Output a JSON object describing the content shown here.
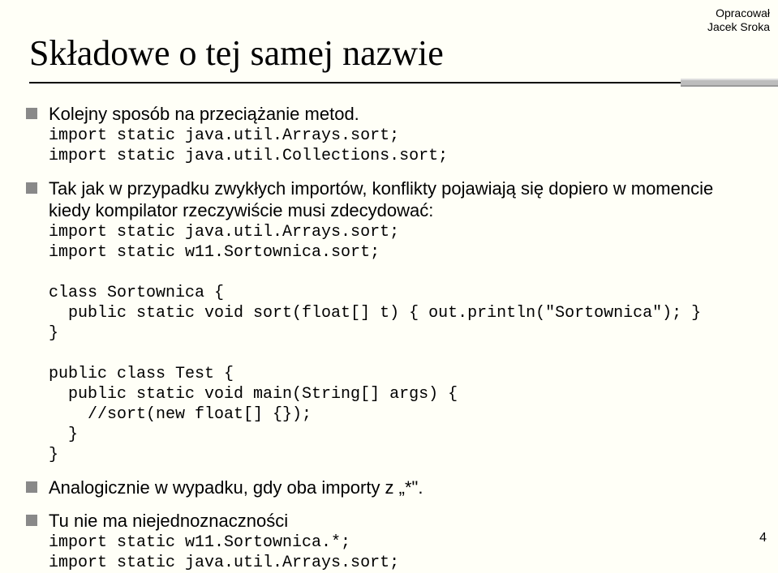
{
  "author": {
    "line1": "Opracował",
    "line2": "Jacek Sroka"
  },
  "title": "Składowe o tej samej nazwie",
  "bullets": {
    "b1": {
      "text": "Kolejny sposób na przeciążanie metod.",
      "code": "import static java.util.Arrays.sort;\nimport static java.util.Collections.sort;"
    },
    "b2": {
      "text": "Tak jak w przypadku zwykłych importów, konflikty pojawiają się dopiero w momencie kiedy kompilator rzeczywiście musi zdecydować:",
      "code": "import static java.util.Arrays.sort;\nimport static w11.Sortownica.sort;\n\nclass Sortownica {\n  public static void sort(float[] t) { out.println(\"Sortownica\"); }\n}\n\npublic class Test {\n  public static void main(String[] args) {\n    //sort(new float[] {});\n  }\n}"
    },
    "b3": {
      "text": "Analogicznie w wypadku, gdy oba importy z „*\"."
    },
    "b4": {
      "text": "Tu nie ma niejednoznaczności",
      "code": "import static w11.Sortownica.*;\nimport static java.util.Arrays.sort;"
    }
  },
  "page_number": "4"
}
